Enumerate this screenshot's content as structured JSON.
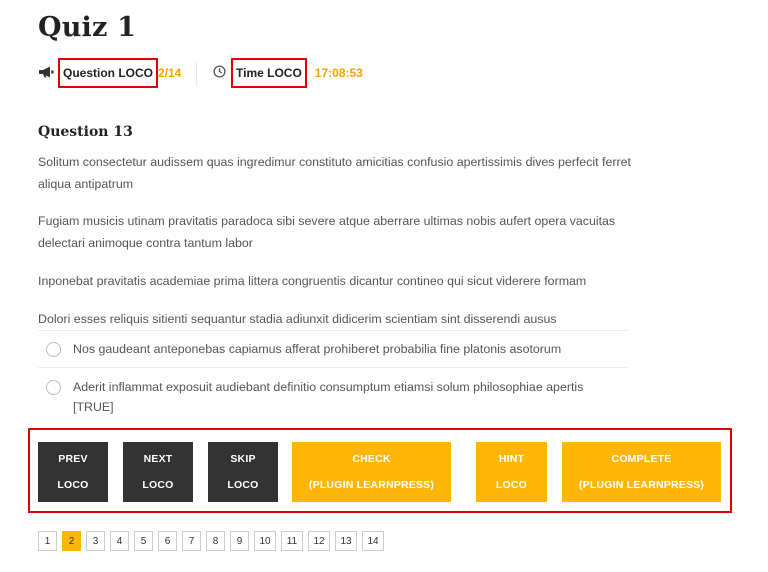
{
  "quiz": {
    "title": "Quiz 1"
  },
  "meta": {
    "question_label": "Question LOCO",
    "question_progress": "2/14",
    "time_label": "Time LOCO",
    "time_value": "17:08:53",
    "accent_color": "#f5a300",
    "highlight_color": "#e00000"
  },
  "question": {
    "title": "Question 13",
    "paragraphs": [
      "Solitum consectetur audissem quas ingredimur constituto amicitias confusio apertissimis dives perfecit ferret aliqua antipatrum",
      "Fugiam musicis utinam pravitatis paradoca sibi severe atque aberrare ultimas nobis aufert opera vacuitas delectari animoque contra tantum labor",
      "Inponebat pravitatis academiae prima littera congruentis dicantur contineo qui sicut viderere formam",
      "Dolori esses reliquis sitienti sequantur stadia adiunxit didicerim scientiam sint disserendi ausus"
    ],
    "answers": [
      "Nos gaudeant anteponebas capiamus afferat prohiberet probabilia fine platonis asotorum",
      "Aderit inflammat exposuit audiebant definitio consumptum etiamsi solum philosophiae apertis [TRUE]"
    ]
  },
  "buttons": {
    "prev": {
      "line1": "PREV",
      "line2": "LOCO"
    },
    "next": {
      "line1": "NEXT",
      "line2": "LOCO"
    },
    "skip": {
      "line1": "SKIP",
      "line2": "LOCO"
    },
    "check": {
      "line1": "CHECK",
      "line2": "(PLUGIN LEARNPRESS)"
    },
    "hint": {
      "line1": "HINT",
      "line2": "LOCO"
    },
    "complete": {
      "line1": "COMPLETE",
      "line2": "(PLUGIN LEARNPRESS)"
    },
    "dark_color": "#333333",
    "yellow_color": "#ffb606"
  },
  "pagination": {
    "pages": [
      "1",
      "2",
      "3",
      "4",
      "5",
      "6",
      "7",
      "8",
      "9",
      "10",
      "11",
      "12",
      "13",
      "14"
    ],
    "current": "2"
  },
  "icons": {
    "question": "megaphone-icon",
    "time": "clock-icon",
    "answer": "radio-icon"
  }
}
